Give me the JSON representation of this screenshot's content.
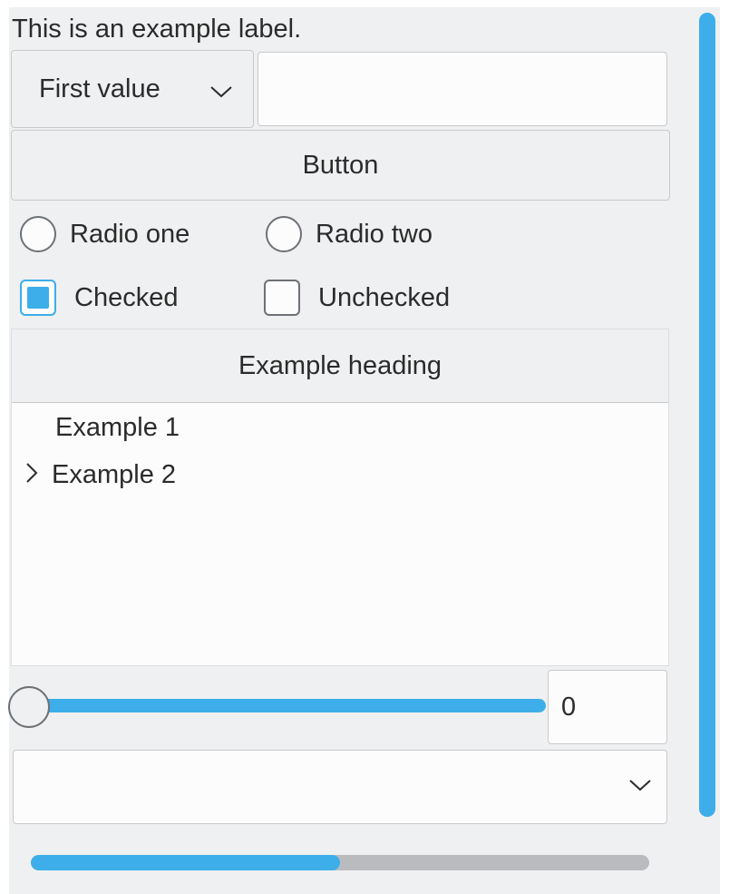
{
  "label": "This is an example label.",
  "combobox": {
    "selected": "First value",
    "icon": "chevron-down-icon"
  },
  "textfield": {
    "value": "",
    "placeholder": ""
  },
  "button": {
    "label": "Button"
  },
  "radios": [
    {
      "label": "Radio one",
      "checked": false
    },
    {
      "label": "Radio two",
      "checked": false
    }
  ],
  "checkboxes": [
    {
      "label": "Checked",
      "checked": true
    },
    {
      "label": "Unchecked",
      "checked": false
    }
  ],
  "tree": {
    "heading": "Example heading",
    "items": [
      {
        "label": "Example 1",
        "expandable": false
      },
      {
        "label": "Example 2",
        "expandable": true
      }
    ]
  },
  "slider": {
    "value": 0
  },
  "spinbox": {
    "value": "0"
  },
  "editable_combo": {
    "value": "",
    "icon": "chevron-down-icon"
  },
  "progress": {
    "fraction": 0.5
  },
  "colors": {
    "accent": "#3daee9",
    "background": "#eff0f1",
    "field": "#fcfcfc",
    "border": "#c8c9cb"
  }
}
